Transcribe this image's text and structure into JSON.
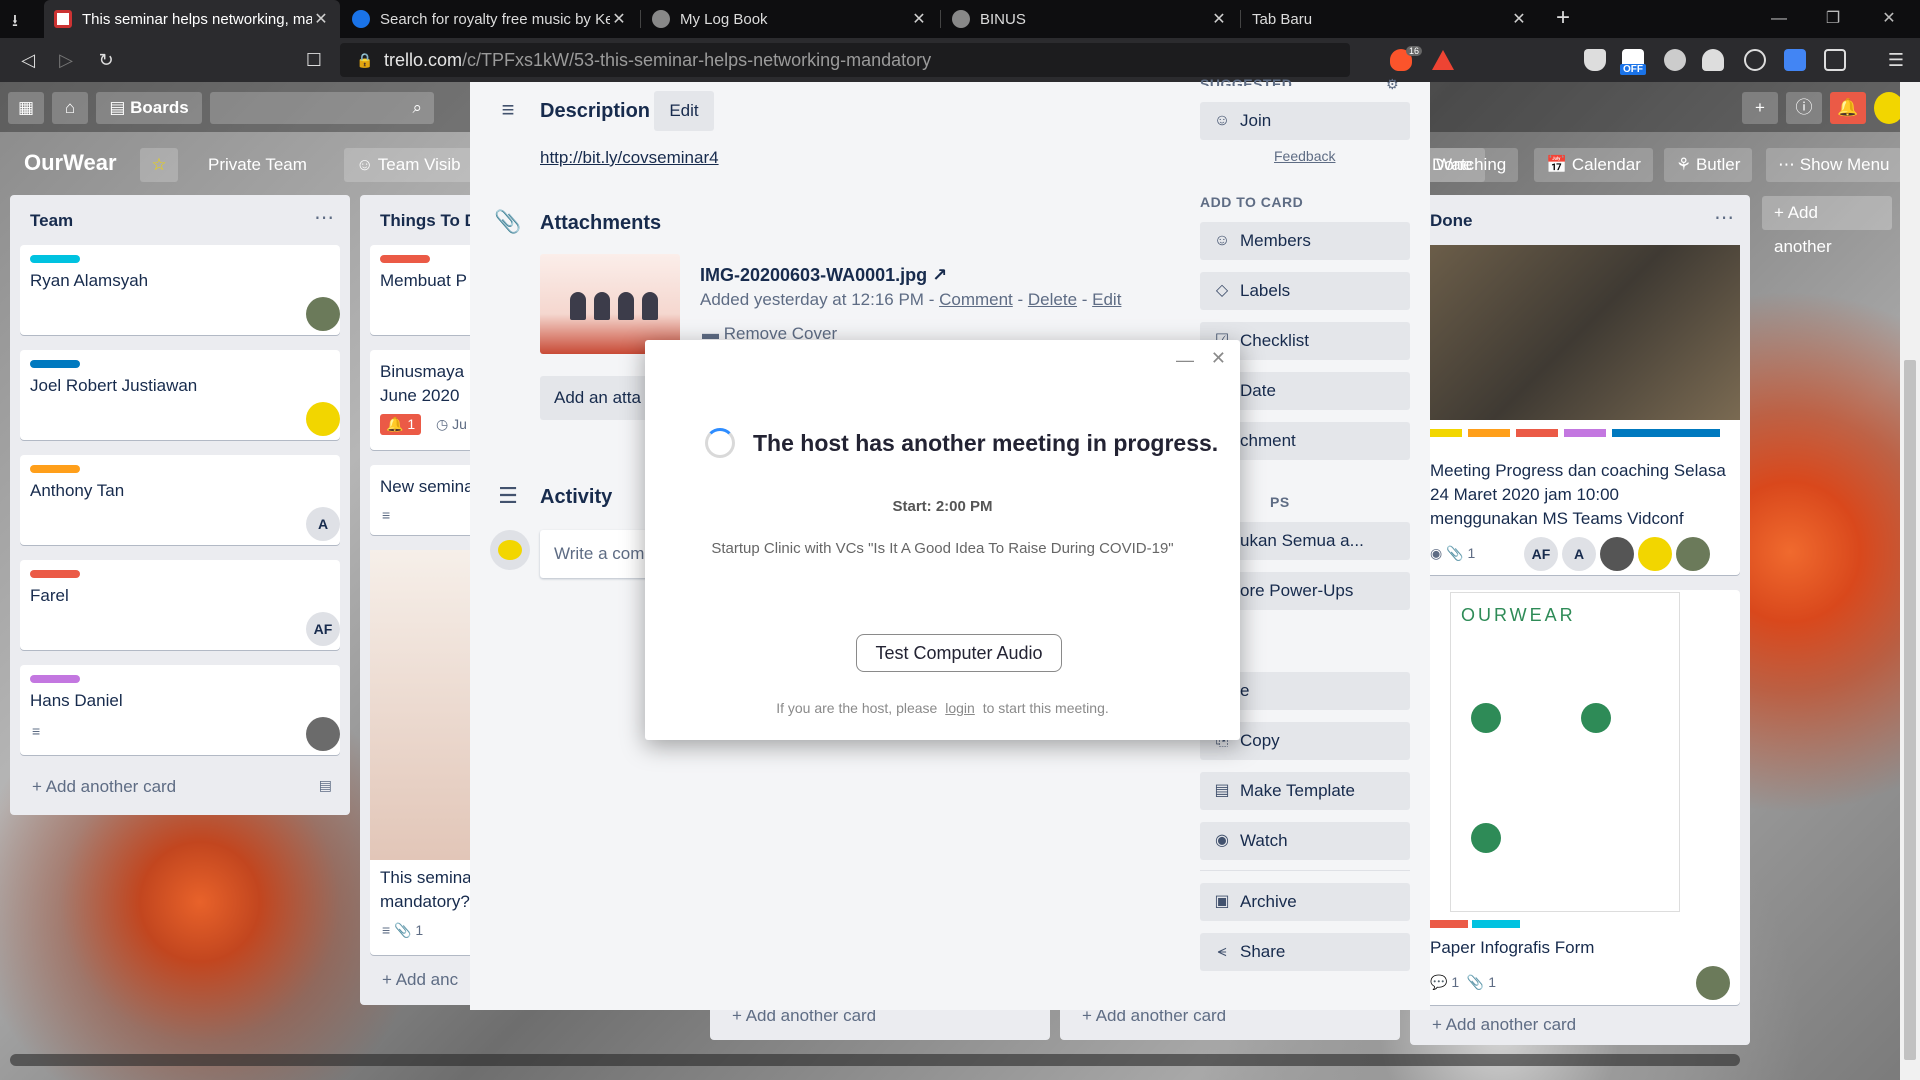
{
  "browser": {
    "tabs": [
      {
        "label": "This seminar helps networking, mandatory",
        "active": true
      },
      {
        "label": "Search for royalty free music by Ke"
      },
      {
        "label": "My Log Book"
      },
      {
        "label": "BINUS"
      },
      {
        "label": "Tab Baru"
      }
    ],
    "url_host": "trello.com",
    "url_path": "/c/TPFxs1kW/53-this-seminar-helps-networking-mandatory",
    "brave_badge": "16",
    "ext_off_badge": "OFF"
  },
  "trello_header": {
    "boards_label": "Boards"
  },
  "board": {
    "title": "OurWear",
    "team_visibility": "Private Team",
    "visibility_btn": "Team Visib",
    "right_buttons": [
      "Watching",
      "Calendar",
      "Butler",
      "Show Menu"
    ],
    "add_another_list": "+ Add another"
  },
  "lists": {
    "team": {
      "title": "Team",
      "cards": [
        {
          "text": "Ryan Alamsyah",
          "label_color": "#00c2e0"
        },
        {
          "text": "Joel Robert Justiawan",
          "label_color": "#0079bf"
        },
        {
          "text": "Anthony Tan",
          "label_color": "#ff9f1a",
          "avatar": "A"
        },
        {
          "text": "Farel",
          "label_color": "#eb5a46",
          "avatar": "AF"
        },
        {
          "text": "Hans Daniel",
          "label_color": "#c377e0"
        }
      ],
      "add_card": "+ Add another card"
    },
    "todo": {
      "title": "Things To D",
      "cards": [
        "Membuat P",
        "Binusmaya",
        "June 2020",
        "New semina",
        "This semina",
        "mandatory?"
      ],
      "badge_count": "1",
      "badge_date": "Ju",
      "attach_count": "1",
      "add_card": "+ Add anc"
    },
    "done": {
      "title": "Done",
      "card1_text": "Meeting Progress dan coaching Selasa 24 Maret 2020 jam 10:00 menggunakan MS Teams Vidconf",
      "card1_attach": "1",
      "card1_avatars": [
        "AF",
        "A"
      ],
      "card2_text": "Paper Infografis Form",
      "card2_comments": "1",
      "card2_attach": "1",
      "poster_title": "OURWEAR",
      "add_card": "+ Add another card"
    },
    "hidden_add_cards": [
      "+ Add another card",
      "+ Add another card"
    ]
  },
  "card_detail": {
    "description": {
      "title": "Description",
      "edit": "Edit",
      "link": "http://bit.ly/covseminar4"
    },
    "attachments": {
      "title": "Attachments",
      "file_name": "IMG-20200603-WA0001.jpg",
      "added_text": "Added yesterday at 12:16 PM - ",
      "comment": "Comment",
      "sep": " - ",
      "delete": "Delete",
      "edit": "Edit",
      "remove_cover": "Remove Cover",
      "add_button": "Add an atta"
    },
    "activity": {
      "title": "Activity",
      "comment_placeholder": "Write a com"
    },
    "sidebar": {
      "suggested_label": "SUGGESTED",
      "join": "Join",
      "feedback": "Feedback",
      "add_to_card_label": "ADD TO CARD",
      "add_items": [
        "Members",
        "Labels",
        "Checklist",
        "Date",
        "chment"
      ],
      "powerups_label": "PS",
      "powerups_items": [
        "ukan Semua a...",
        "ore Power-Ups"
      ],
      "action_items": [
        "e",
        "Copy",
        "Make Template",
        "Watch",
        "Archive",
        "Share"
      ]
    }
  },
  "zoom_dialog": {
    "title": "The host has another meeting in progress.",
    "start": "Start: 2:00 PM",
    "topic": "Startup Clinic with VCs \"Is It A Good Idea To Raise During COVID-19\"",
    "audio_button": "Test Computer Audio",
    "footer_pre": "If you are the host, please",
    "footer_link": "login",
    "footer_post": "to start this meeting."
  }
}
